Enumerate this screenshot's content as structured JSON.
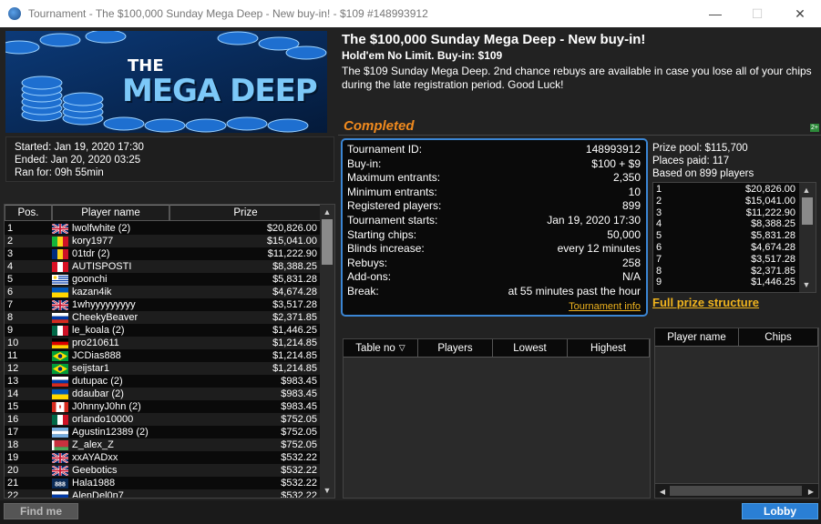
{
  "window": {
    "title": "Tournament - The $100,000 Sunday Mega Deep - New buy-in! - $109 #148993912",
    "minimize": "—",
    "maximize": "☐",
    "close": "✕"
  },
  "banner": {
    "line1": "THE",
    "line2": "MEGA DEEP"
  },
  "timing": {
    "started": "Started: Jan 19, 2020 17:30",
    "ended": "Ended: Jan 20, 2020 03:25",
    "ran": "Ran for: 09h 55min"
  },
  "tournament": {
    "title": "The $100,000 Sunday Mega Deep - New buy-in!",
    "subtitle": "Hold'em No Limit. Buy-in: $109",
    "description": "The $109 Sunday Mega Deep. 2nd chance rebuys are available in case you lose all of your chips during the late registration period. Good Luck!",
    "status": "Completed",
    "status_color": "#f08a1e"
  },
  "details": [
    {
      "label": "Tournament ID:",
      "value": "148993912"
    },
    {
      "label": "Buy-in:",
      "value": "$100 + $9"
    },
    {
      "label": "Maximum entrants:",
      "value": "2,350"
    },
    {
      "label": "Minimum entrants:",
      "value": "10"
    },
    {
      "label": "Registered players:",
      "value": "899"
    },
    {
      "label": "Tournament starts:",
      "value": "Jan 19, 2020 17:30"
    },
    {
      "label": "Starting chips:",
      "value": "50,000"
    },
    {
      "label": "Blinds increase:",
      "value": "every 12 minutes"
    },
    {
      "label": "Rebuys:",
      "value": "258"
    },
    {
      "label": "Add-ons:",
      "value": "N/A"
    },
    {
      "label": "Break:",
      "value": "at 55 minutes past the hour"
    }
  ],
  "tournament_info_link": "Tournament info",
  "prize": {
    "pool": "Prize pool: $115,700",
    "places": "Places paid: 117",
    "based": "Based on 899 players",
    "list": [
      {
        "place": "1",
        "amount": "$20,826.00"
      },
      {
        "place": "2",
        "amount": "$15,041.00"
      },
      {
        "place": "3",
        "amount": "$11,222.90"
      },
      {
        "place": "4",
        "amount": "$8,388.25"
      },
      {
        "place": "5",
        "amount": "$5,831.28"
      },
      {
        "place": "6",
        "amount": "$4,674.28"
      },
      {
        "place": "7",
        "amount": "$3,517.28"
      },
      {
        "place": "8",
        "amount": "$2,371.85"
      },
      {
        "place": "9",
        "amount": "$1,446.25"
      }
    ],
    "full_structure": "Full prize structure"
  },
  "players_table": {
    "headers": [
      "Pos.",
      "Player name",
      "Prize"
    ],
    "rows": [
      {
        "pos": "1",
        "flag": "gb",
        "name": "lwolfwhite (2)",
        "prize": "$20,826.00"
      },
      {
        "pos": "2",
        "flag": "ml",
        "name": "kory1977",
        "prize": "$15,041.00"
      },
      {
        "pos": "3",
        "flag": "ro",
        "name": "01tdr (2)",
        "prize": "$11,222.90"
      },
      {
        "pos": "4",
        "flag": "pe",
        "name": "AUTISPOSTI",
        "prize": "$8,388.25"
      },
      {
        "pos": "5",
        "flag": "uy",
        "name": "goonchi",
        "prize": "$5,831.28"
      },
      {
        "pos": "6",
        "flag": "ua",
        "name": "kazan4ik",
        "prize": "$4,674.28"
      },
      {
        "pos": "7",
        "flag": "gb",
        "name": "1whyyyyyyyyy",
        "prize": "$3,517.28"
      },
      {
        "pos": "8",
        "flag": "ru",
        "name": "CheekyBeaver",
        "prize": "$2,371.85"
      },
      {
        "pos": "9",
        "flag": "mx",
        "name": "le_koala (2)",
        "prize": "$1,446.25"
      },
      {
        "pos": "10",
        "flag": "de",
        "name": "pro210611",
        "prize": "$1,214.85"
      },
      {
        "pos": "11",
        "flag": "br",
        "name": "JCDias888",
        "prize": "$1,214.85"
      },
      {
        "pos": "12",
        "flag": "br",
        "name": "seijstar1",
        "prize": "$1,214.85"
      },
      {
        "pos": "13",
        "flag": "ru",
        "name": "dutupac (2)",
        "prize": "$983.45"
      },
      {
        "pos": "14",
        "flag": "ua",
        "name": "ddaubar (2)",
        "prize": "$983.45"
      },
      {
        "pos": "15",
        "flag": "ca",
        "name": "J0hnnyJ0hn (2)",
        "prize": "$983.45"
      },
      {
        "pos": "16",
        "flag": "mx",
        "name": "orlando10000",
        "prize": "$752.05"
      },
      {
        "pos": "17",
        "flag": "ar",
        "name": "Agustin12389 (2)",
        "prize": "$752.05"
      },
      {
        "pos": "18",
        "flag": "by",
        "name": "Z_alex_Z",
        "prize": "$752.05"
      },
      {
        "pos": "19",
        "flag": "gb",
        "name": "xxAYADxx",
        "prize": "$532.22"
      },
      {
        "pos": "20",
        "flag": "gb",
        "name": "Geebotics",
        "prize": "$532.22"
      },
      {
        "pos": "21",
        "flag": "888",
        "name": "Hala1988",
        "prize": "$532.22"
      },
      {
        "pos": "22",
        "flag": "ru",
        "name": "AlenDel0n7",
        "prize": "$532.22"
      }
    ]
  },
  "tables_list": {
    "headers": [
      "Table no",
      "Players",
      "Lowest",
      "Highest"
    ]
  },
  "table_players": {
    "headers": [
      "Player name",
      "Chips"
    ]
  },
  "buttons": {
    "find_me": "Find me",
    "lobby": "Lobby"
  },
  "icons": {
    "small_badge": "2+"
  }
}
